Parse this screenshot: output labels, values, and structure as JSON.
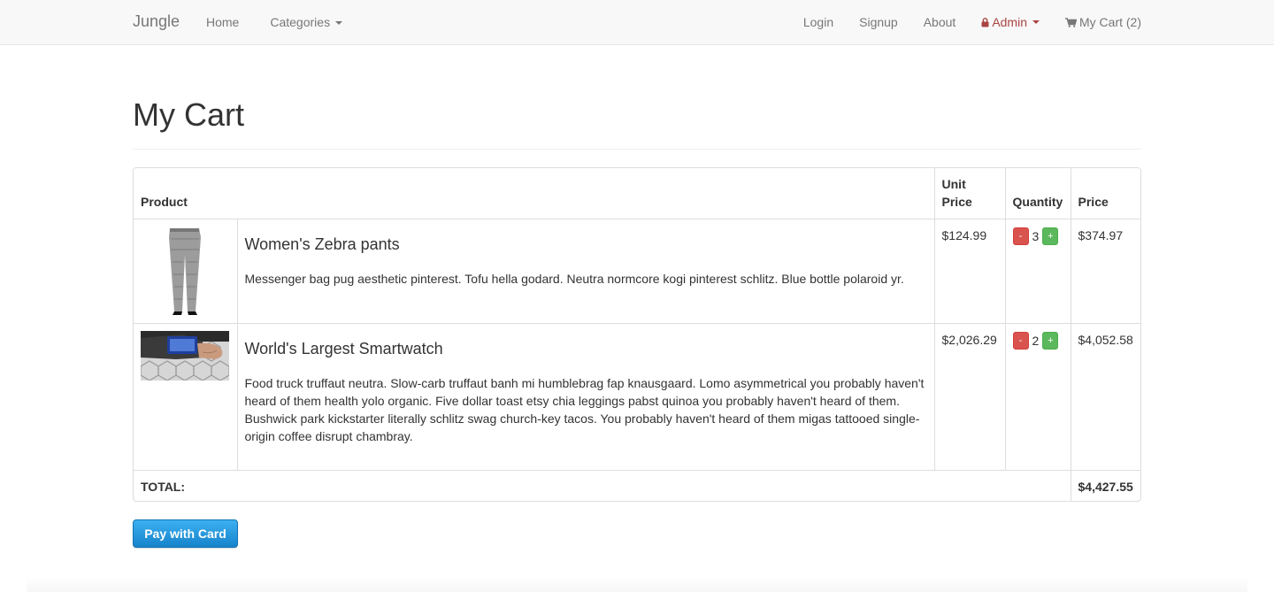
{
  "nav": {
    "brand": "Jungle",
    "home": "Home",
    "categories": "Categories",
    "login": "Login",
    "signup": "Signup",
    "about": "About",
    "admin": "Admin",
    "cart": "My Cart (2)"
  },
  "icons": {
    "admin_icon": "lock-icon",
    "cart_icon": "shopping-cart-icon",
    "categories_caret": "caret-down-icon"
  },
  "colors": {
    "admin": "#a94442",
    "minus_button": "#d9534f",
    "plus_button": "#5cb85c",
    "pay_button": "#1b8fd9"
  },
  "page": {
    "title": "My Cart"
  },
  "table": {
    "headers": {
      "product": "Product",
      "unit_price": "Unit Price",
      "quantity": "Quantity",
      "price": "Price"
    },
    "items": [
      {
        "name": "Women's Zebra pants",
        "description": "Messenger bag pug aesthetic pinterest. Tofu hella godard. Neutra normcore kogi pinterest schlitz. Blue bottle polaroid yr.",
        "unit_price": "$124.99",
        "quantity": "3",
        "price": "$374.97",
        "minus": "-",
        "plus": "+"
      },
      {
        "name": "World's Largest Smartwatch",
        "description": "Food truck truffaut neutra. Slow-carb truffaut banh mi humblebrag fap knausgaard. Lomo asymmetrical you probably haven't heard of them health yolo organic. Five dollar toast etsy chia leggings pabst quinoa you probably haven't heard of them. Bushwick park kickstarter literally schlitz swag church-key tacos. You probably haven't heard of them migas tattooed single-origin coffee disrupt chambray.",
        "unit_price": "$2,026.29",
        "quantity": "2",
        "price": "$4,052.58",
        "minus": "-",
        "plus": "+"
      }
    ],
    "total_label": "TOTAL:",
    "total_value": "$4,427.55"
  },
  "pay_button": "Pay with Card"
}
